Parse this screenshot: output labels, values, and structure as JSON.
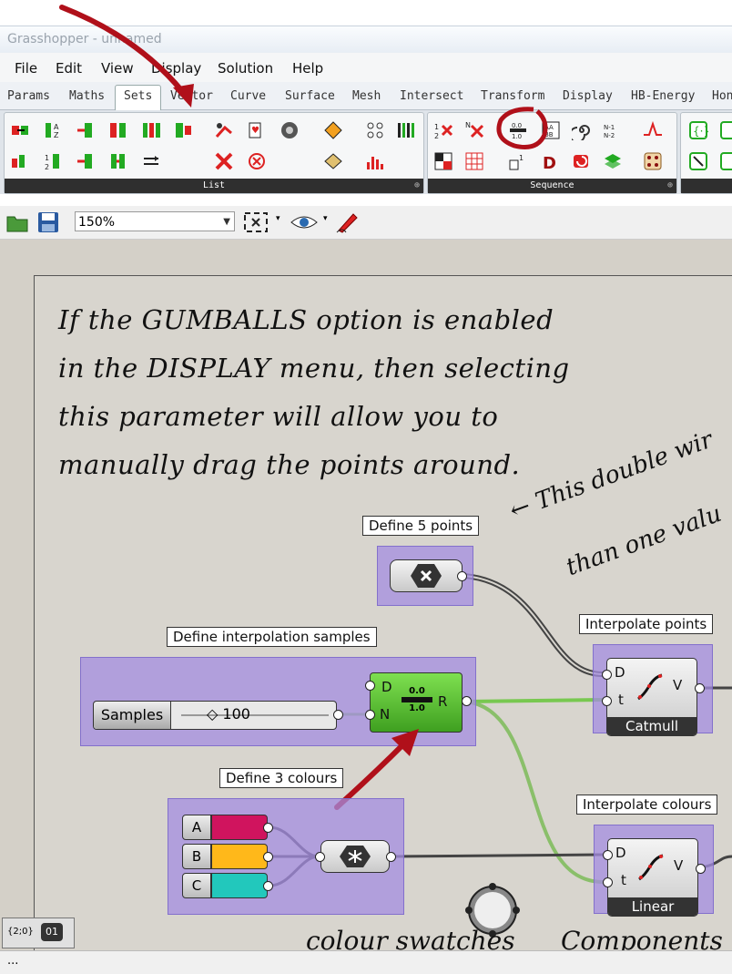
{
  "window": {
    "title": "Grasshopper - unnamed"
  },
  "menu": [
    "File",
    "Edit",
    "View",
    "Display",
    "Solution",
    "Help"
  ],
  "tabs": [
    "Params",
    "Maths",
    "Sets",
    "Vector",
    "Curve",
    "Surface",
    "Mesh",
    "Intersect",
    "Transform",
    "Display",
    "HB-Energy",
    "Hon"
  ],
  "active_tab": "Sets",
  "ribbon": {
    "group_list": "List",
    "group_sequence": "Sequence",
    "pin": "⊕"
  },
  "toolbar": {
    "zoom": "150%"
  },
  "canvas": {
    "note_lines": [
      "If the GUMBALLS option is enabled",
      "in the DISPLAY menu, then selecting",
      "this parameter will allow you to",
      "manually drag the points around."
    ],
    "side_note_1": "← This double wir",
    "side_note_2": "than one valu",
    "bottom_left": "colour swatches",
    "bottom_right": "Components",
    "groups": {
      "points": "Define 5 points",
      "samples": "Define interpolation samples",
      "colours": "Define 3 colours",
      "interp_points": "Interpolate points",
      "interp_colours": "Interpolate colours"
    },
    "slider": {
      "name": "Samples",
      "value": "◇ 100"
    },
    "range": {
      "in1": "D",
      "in2": "N",
      "out": "R",
      "icon_top": "0.0",
      "icon_bot": "1.0"
    },
    "catmull": {
      "in1": "D",
      "in2": "t",
      "out": "V",
      "name": "Catmull"
    },
    "linear": {
      "in1": "D",
      "in2": "t",
      "out": "V",
      "name": "Linear"
    },
    "swatches": [
      {
        "letter": "A",
        "color": "#d0145e"
      },
      {
        "letter": "B",
        "color": "#ffb81a"
      },
      {
        "letter": "C",
        "color": "#22c8bc"
      }
    ]
  },
  "widget": {
    "text1": "{2;0}",
    "text2": "01"
  },
  "status": {
    "text": "..."
  }
}
